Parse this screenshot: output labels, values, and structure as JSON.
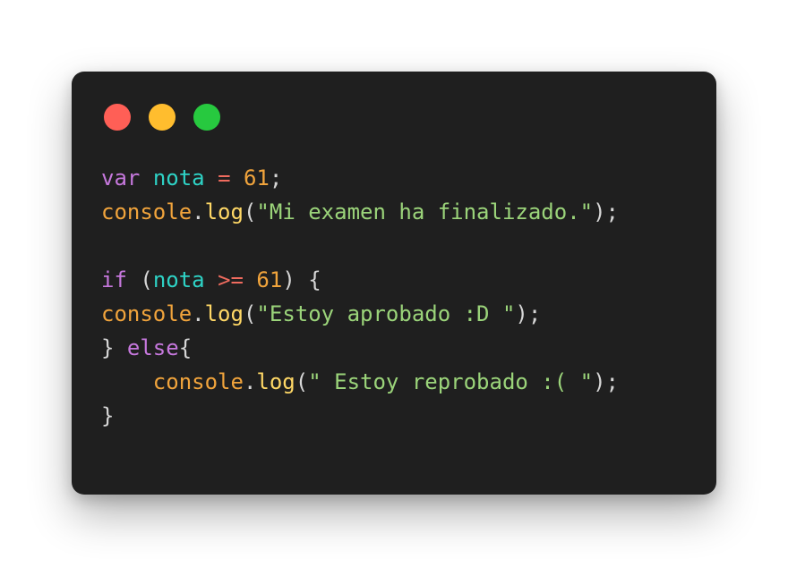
{
  "window": {
    "background": "#1f1f1f",
    "controls": [
      {
        "name": "close-button",
        "color": "#ff5f56"
      },
      {
        "name": "minimize-button",
        "color": "#ffbd2e"
      },
      {
        "name": "maximize-button",
        "color": "#27c93f"
      }
    ]
  },
  "colors": {
    "keyword": "#c678dd",
    "variable": "#2ed3c6",
    "operator": "#ef6b5e",
    "number": "#f1a43c",
    "object": "#f1a43c",
    "method": "#ffd866",
    "string": "#9bd47a",
    "plain": "#d6d6d6"
  },
  "code": {
    "lines": [
      [
        {
          "t": "var",
          "c": "keyword"
        },
        {
          "t": " ",
          "c": "plain"
        },
        {
          "t": "nota",
          "c": "variable"
        },
        {
          "t": " ",
          "c": "plain"
        },
        {
          "t": "=",
          "c": "operator"
        },
        {
          "t": " ",
          "c": "plain"
        },
        {
          "t": "61",
          "c": "number"
        },
        {
          "t": ";",
          "c": "plain"
        }
      ],
      [
        {
          "t": "console",
          "c": "object"
        },
        {
          "t": ".",
          "c": "plain"
        },
        {
          "t": "log",
          "c": "method"
        },
        {
          "t": "(",
          "c": "plain"
        },
        {
          "t": "\"Mi examen ha finalizado.\"",
          "c": "string"
        },
        {
          "t": ");",
          "c": "plain"
        }
      ],
      [],
      [
        {
          "t": "if",
          "c": "keyword"
        },
        {
          "t": " (",
          "c": "plain"
        },
        {
          "t": "nota",
          "c": "variable"
        },
        {
          "t": " ",
          "c": "plain"
        },
        {
          "t": ">=",
          "c": "operator"
        },
        {
          "t": " ",
          "c": "plain"
        },
        {
          "t": "61",
          "c": "number"
        },
        {
          "t": ") {",
          "c": "plain"
        }
      ],
      [
        {
          "t": "console",
          "c": "object"
        },
        {
          "t": ".",
          "c": "plain"
        },
        {
          "t": "log",
          "c": "method"
        },
        {
          "t": "(",
          "c": "plain"
        },
        {
          "t": "\"Estoy aprobado :D \"",
          "c": "string"
        },
        {
          "t": ");",
          "c": "plain"
        }
      ],
      [
        {
          "t": "} ",
          "c": "plain"
        },
        {
          "t": "else",
          "c": "keyword"
        },
        {
          "t": "{",
          "c": "plain"
        }
      ],
      [
        {
          "t": "    ",
          "c": "plain"
        },
        {
          "t": "console",
          "c": "object"
        },
        {
          "t": ".",
          "c": "plain"
        },
        {
          "t": "log",
          "c": "method"
        },
        {
          "t": "(",
          "c": "plain"
        },
        {
          "t": "\" Estoy reprobado :( \"",
          "c": "string"
        },
        {
          "t": ");",
          "c": "plain"
        }
      ],
      [
        {
          "t": "}",
          "c": "plain"
        }
      ]
    ]
  }
}
